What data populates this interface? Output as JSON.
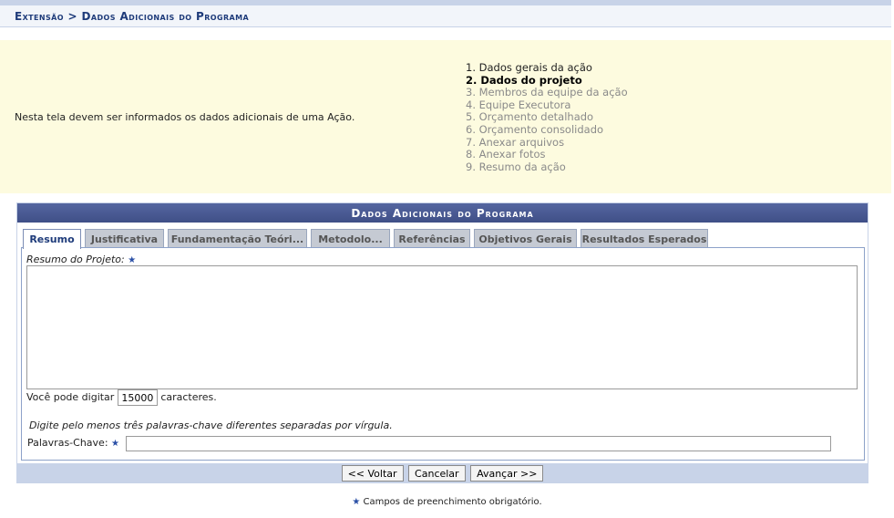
{
  "breadcrumb": {
    "text": "Extensão > Dados Adicionais do Programa"
  },
  "help": {
    "text": "Nesta tela devem ser informados os dados adicionais de uma Ação.",
    "steps": [
      "1. Dados gerais da ação",
      "2. Dados do projeto",
      "3. Membros da equipe da ação",
      "4. Equipe Executora",
      "5. Orçamento detalhado",
      "6. Orçamento consolidado",
      "7. Anexar arquivos",
      "8. Anexar fotos",
      "9. Resumo da ação"
    ],
    "current_step": "2. Dados do projeto"
  },
  "panel": {
    "title": "Dados Adicionais do Programa",
    "tabs": [
      "Resumo",
      "Justificativa",
      "Fundamentação Teóri...",
      "Metodolo...",
      "Referências",
      "Objetivos Gerais",
      "Resultados Esperados"
    ],
    "active_tab": "Resumo"
  },
  "form": {
    "resumo_label": "Resumo do Projeto:",
    "resumo_value": "",
    "chars_prefix": "Você pode digitar",
    "chars_remaining": "15000",
    "chars_suffix": "caracteres.",
    "keywords_hint": "Digite pelo menos três palavras-chave diferentes separadas por vírgula.",
    "keywords_label": "Palavras-Chave:",
    "keywords_value": "",
    "required_star": "★"
  },
  "buttons": {
    "back": "<< Voltar",
    "cancel": "Cancelar",
    "next": "Avançar >>"
  },
  "footnote": {
    "text": "Campos de preenchimento obrigatório."
  },
  "colors": {
    "title_bar": "#3f4f87",
    "help_bg": "#fdfbdf",
    "accent": "#1e3b7a"
  }
}
